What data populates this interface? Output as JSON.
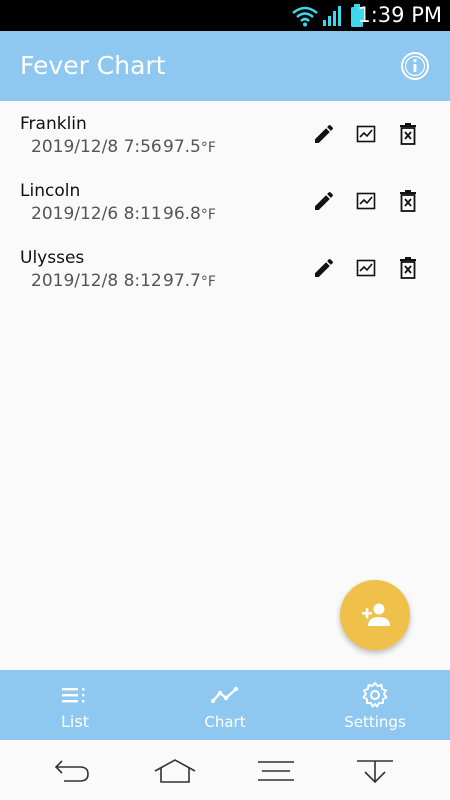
{
  "status_bar": {
    "time": "1:39 PM"
  },
  "app_bar": {
    "title": "Fever Chart",
    "info_icon": "info-icon"
  },
  "people": [
    {
      "name": "Franklin",
      "date": "2019/12/8 7:56",
      "temp": "97.5",
      "unit": "°F"
    },
    {
      "name": "Lincoln",
      "date": "2019/12/6 8:11",
      "temp": "96.8",
      "unit": "°F"
    },
    {
      "name": "Ulysses",
      "date": "2019/12/8 8:12",
      "temp": "97.7",
      "unit": "°F"
    }
  ],
  "fab": {
    "icon": "add-person-icon"
  },
  "bottom_nav": {
    "list_label": "List",
    "chart_label": "Chart",
    "settings_label": "Settings"
  },
  "colors": {
    "app_bar": "#8ec7ef",
    "fab": "#efc14a",
    "background": "#fafafa"
  }
}
